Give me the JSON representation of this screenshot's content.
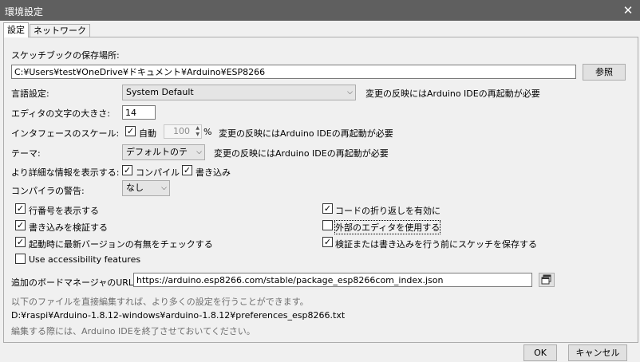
{
  "window": {
    "title": "環境設定",
    "close_glyph": "✕"
  },
  "tabs": [
    {
      "label": "設定"
    },
    {
      "label": "ネットワーク"
    }
  ],
  "sketchbook": {
    "label": "スケッチブックの保存場所:",
    "path": "C:¥Users¥test¥OneDrive¥ドキュメント¥Arduino¥ESP8266",
    "browse_label": "参照"
  },
  "language": {
    "label": "言語設定:",
    "value": "System Default",
    "note": "変更の反映にはArduino IDEの再起動が必要"
  },
  "font_size": {
    "label": "エディタの文字の大きさ:",
    "value": "14"
  },
  "scale": {
    "label": "インタフェースのスケール:",
    "auto_label": "自動",
    "auto_checked": true,
    "value": "100",
    "unit": "%",
    "note": "変更の反映にはArduino IDEの再起動が必要"
  },
  "theme": {
    "label": "テーマ:",
    "value": "デフォルトのテー…",
    "note": "変更の反映にはArduino IDEの再起動が必要"
  },
  "verbose": {
    "label": "より詳細な情報を表示する:",
    "compile_label": "コンパイル",
    "compile_checked": true,
    "upload_label": "書き込み",
    "upload_checked": true
  },
  "warnings": {
    "label": "コンパイラの警告:",
    "value": "なし"
  },
  "options": {
    "line_numbers": {
      "label": "行番号を表示する",
      "checked": true
    },
    "verify_upload": {
      "label": "書き込みを検証する",
      "checked": true
    },
    "check_updates": {
      "label": "起動時に最新バージョンの有無をチェックする",
      "checked": true
    },
    "accessibility": {
      "label": "Use accessibility features",
      "checked": false
    },
    "code_folding": {
      "label": "コードの折り返しを有効に",
      "checked": true
    },
    "external_editor": {
      "label": "外部のエディタを使用する",
      "checked": false
    },
    "save_before_verify": {
      "label": "検証または書き込みを行う前にスケッチを保存する",
      "checked": true
    }
  },
  "boards_manager": {
    "label": "追加のボードマネージャのURL:",
    "url": "https://arduino.esp8266.com/stable/package_esp8266com_index.json"
  },
  "info": {
    "more_prefs": "以下のファイルを直接編集すれば、より多くの設定を行うことができます。",
    "prefs_path": "D:¥raspi¥Arduino-1.8.12-windows¥arduino-1.8.12¥preferences_esp8266.txt",
    "edit_note": "編集する際には、Arduino IDEを終了させておいてください。"
  },
  "footer": {
    "ok_label": "OK",
    "cancel_label": "キャンセル"
  },
  "icons": {
    "check": "✓",
    "dropdown": "⌵",
    "spin_up": "▲",
    "spin_down": "▼"
  }
}
